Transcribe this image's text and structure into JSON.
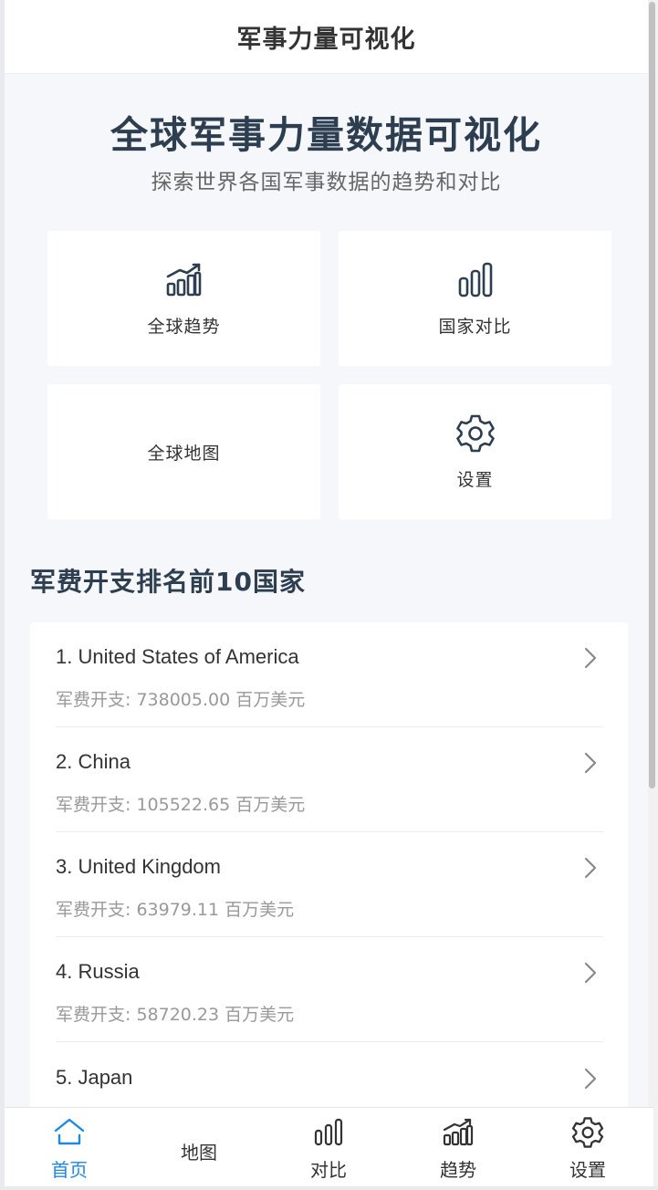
{
  "nav": {
    "title": "军事力量可视化"
  },
  "hero": {
    "title": "全球军事力量数据可视化",
    "subtitle": "探索世界各国军事数据的趋势和对比"
  },
  "cards": [
    {
      "label": "全球趋势",
      "icon": "trend-chart-icon"
    },
    {
      "label": "国家对比",
      "icon": "bar-chart-icon"
    },
    {
      "label": "全球地图",
      "icon": ""
    },
    {
      "label": "设置",
      "icon": "gear-icon"
    }
  ],
  "ranking": {
    "title": "军费开支排名前10国家",
    "items": [
      {
        "name": "1. United States of America",
        "value": "军费开支: 738005.00 百万美元"
      },
      {
        "name": "2. China",
        "value": "军费开支: 105522.65 百万美元"
      },
      {
        "name": "3. United Kingdom",
        "value": "军费开支: 63979.11 百万美元"
      },
      {
        "name": "4. Russia",
        "value": "军费开支: 58720.23 百万美元"
      },
      {
        "name": "5. Japan",
        "value": ""
      }
    ]
  },
  "tabbar": [
    {
      "label": "首页",
      "icon": "home-icon",
      "active": true
    },
    {
      "label": "地图",
      "icon": ""
    },
    {
      "label": "对比",
      "icon": "bar-chart-icon"
    },
    {
      "label": "趋势",
      "icon": "trend-chart-icon"
    },
    {
      "label": "设置",
      "icon": "gear-icon"
    }
  ],
  "colors": {
    "accent": "#1e88e5",
    "heading": "#2c3e50",
    "background": "#f5f7fa",
    "muted": "#999999"
  }
}
